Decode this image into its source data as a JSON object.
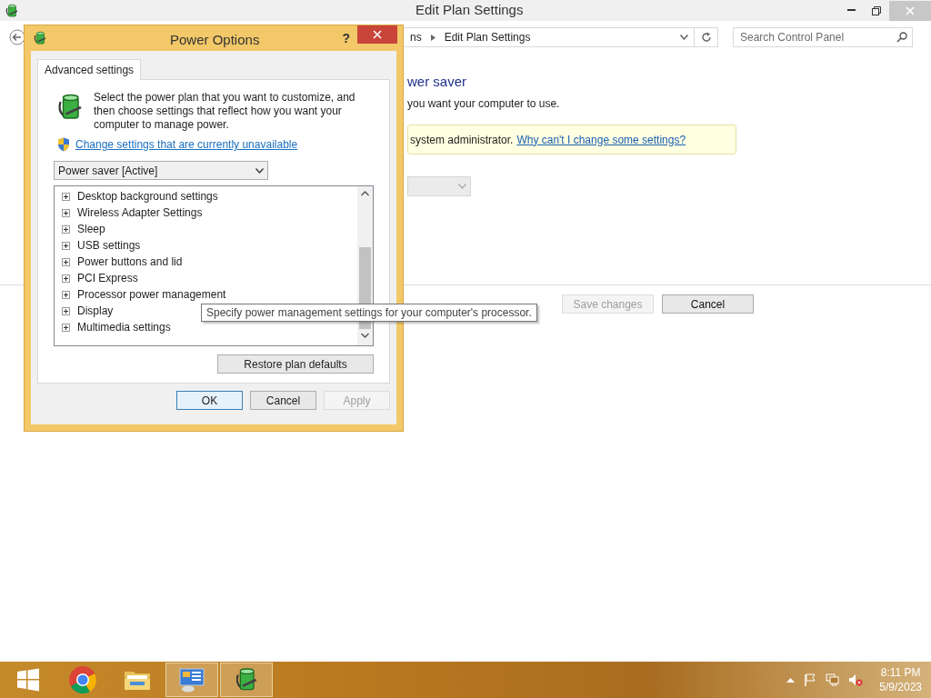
{
  "background_window": {
    "title": "Edit Plan Settings",
    "breadcrumb": [
      "ns",
      "Edit Plan Settings"
    ],
    "search": {
      "placeholder": "Search Control Panel"
    },
    "heading": "wer saver",
    "subtitle": "you want your computer to use.",
    "notice": {
      "text": "system administrator.",
      "link": "Why can't I change some settings?"
    },
    "buttons": [
      {
        "label": "Save changes",
        "disabled": true
      },
      {
        "label": "Cancel",
        "disabled": false
      }
    ]
  },
  "dialog": {
    "title": "Power Options",
    "help": "?",
    "tabs": [
      {
        "label": "Advanced settings",
        "selected": true
      }
    ],
    "intro": "Select the power plan that you want to customize, and then choose settings that reflect how you want your computer to manage power.",
    "link": "Change settings that are currently unavailable",
    "plan_select": {
      "value": "Power saver [Active]"
    },
    "settings": [
      {
        "label": "Desktop background settings",
        "expanded": false
      },
      {
        "label": "Wireless Adapter Settings",
        "expanded": false
      },
      {
        "label": "Sleep",
        "expanded": false
      },
      {
        "label": "USB settings",
        "expanded": false
      },
      {
        "label": "Power buttons and lid",
        "expanded": false
      },
      {
        "label": "PCI Express",
        "expanded": false
      },
      {
        "label": "Processor power management",
        "expanded": false
      },
      {
        "label": "Display",
        "expanded": false
      },
      {
        "label": "Multimedia settings",
        "expanded": false
      }
    ],
    "restore_button": "Restore plan defaults",
    "buttons": [
      {
        "label": "OK",
        "disabled": false,
        "default": true
      },
      {
        "label": "Cancel",
        "disabled": false,
        "default": false
      },
      {
        "label": "Apply",
        "disabled": true,
        "default": false
      }
    ]
  },
  "tooltip": "Specify power management settings for your computer's processor.",
  "taskbar": {
    "apps": [
      {
        "kind": "start",
        "selected": false
      },
      {
        "kind": "browser",
        "selected": false
      },
      {
        "kind": "folder",
        "selected": false
      },
      {
        "kind": "control-panel",
        "selected": true
      },
      {
        "kind": "battery",
        "selected": true
      }
    ],
    "clock": {
      "time": "8:11 PM",
      "date": "5/9/2023"
    }
  }
}
